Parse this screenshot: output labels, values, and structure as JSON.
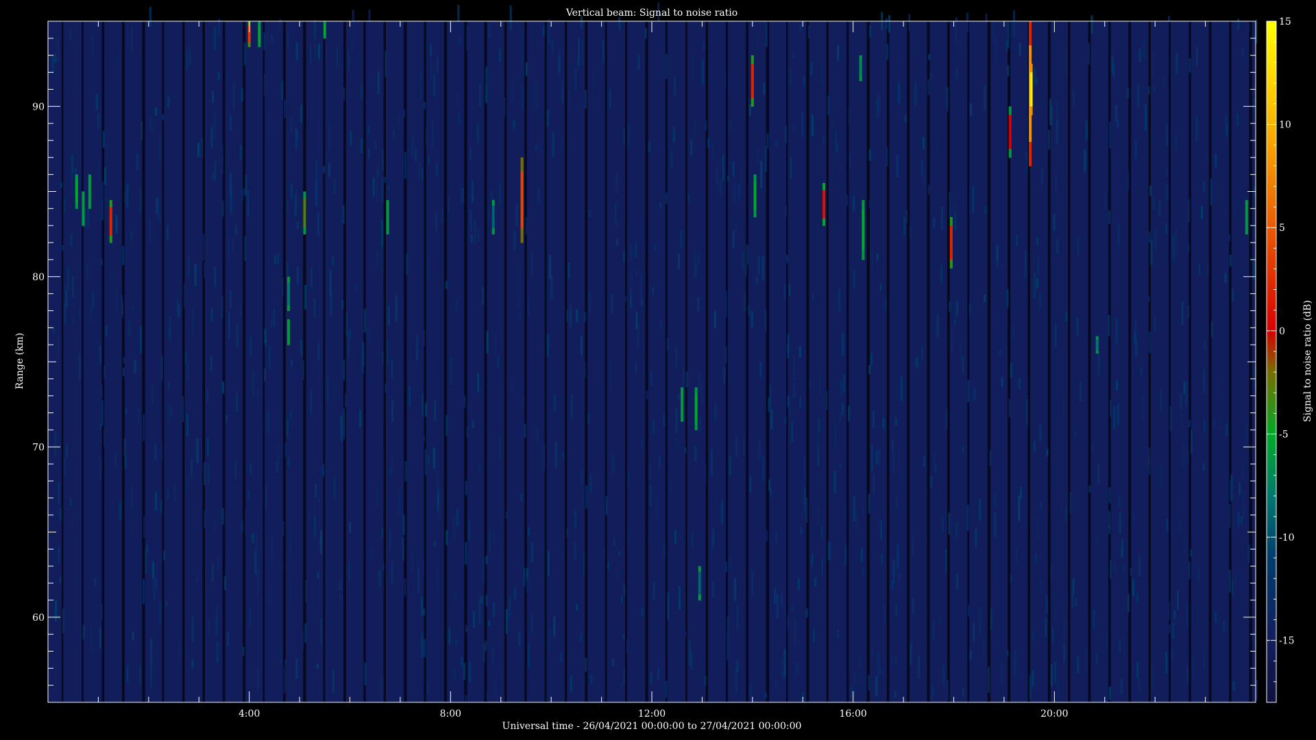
{
  "chart_data": {
    "type": "heatmap",
    "title": "Vertical beam: Signal to noise ratio",
    "xlabel": "Universal time - 26/04/2021 00:00:00 to 27/04/2021 00:00:00",
    "ylabel": "Range (km)",
    "colorbar_label": "Signal to noise ratio (dB)",
    "xlim": [
      0,
      24
    ],
    "ylim": [
      55,
      95
    ],
    "clim": [
      -18,
      15
    ],
    "x_ticks": [
      {
        "value": 4,
        "label": "4:00"
      },
      {
        "value": 8,
        "label": "8:00"
      },
      {
        "value": 12,
        "label": "12:00"
      },
      {
        "value": 16,
        "label": "16:00"
      },
      {
        "value": 20,
        "label": "20:00"
      }
    ],
    "y_ticks": [
      {
        "value": 60,
        "label": "60"
      },
      {
        "value": 70,
        "label": "70"
      },
      {
        "value": 80,
        "label": "80"
      },
      {
        "value": 90,
        "label": "90"
      }
    ],
    "colorbar_ticks": [
      {
        "value": 15,
        "label": "15"
      },
      {
        "value": 10,
        "label": "10"
      },
      {
        "value": 5,
        "label": "5"
      },
      {
        "value": 0,
        "label": "0"
      },
      {
        "value": -5,
        "label": "-5"
      },
      {
        "value": -10,
        "label": "-10"
      },
      {
        "value": -15,
        "label": "-15"
      }
    ],
    "background_snr_db": -15,
    "grid": false,
    "echoes": [
      {
        "t": 0.57,
        "r0": 84,
        "r1": 86,
        "snr": -5
      },
      {
        "t": 0.7,
        "r0": 83,
        "r1": 85,
        "snr": -6
      },
      {
        "t": 0.83,
        "r0": 84,
        "r1": 86,
        "snr": -6
      },
      {
        "t": 1.25,
        "r0": 82,
        "r1": 84.5,
        "snr": 2
      },
      {
        "t": 4.0,
        "r0": 93.5,
        "r1": 95,
        "snr": 3
      },
      {
        "t": 4.2,
        "r0": 93.5,
        "r1": 95,
        "snr": -5
      },
      {
        "t": 4.78,
        "r0": 78,
        "r1": 80,
        "snr": -8
      },
      {
        "t": 4.78,
        "r0": 76,
        "r1": 77.5,
        "snr": -6
      },
      {
        "t": 5.1,
        "r0": 82.5,
        "r1": 85,
        "snr": -3
      },
      {
        "t": 5.5,
        "r0": 94,
        "r1": 95,
        "snr": -5
      },
      {
        "t": 6.75,
        "r0": 82.5,
        "r1": 84.5,
        "snr": -6
      },
      {
        "t": 8.85,
        "r0": 82.5,
        "r1": 84.5,
        "snr": -9
      },
      {
        "t": 9.42,
        "r0": 82,
        "r1": 87,
        "snr": 4
      },
      {
        "t": 12.6,
        "r0": 71.5,
        "r1": 73.5,
        "snr": -6
      },
      {
        "t": 12.88,
        "r0": 71,
        "r1": 73.5,
        "snr": -5
      },
      {
        "t": 12.95,
        "r0": 61,
        "r1": 63,
        "snr": -9
      },
      {
        "t": 14.0,
        "r0": 90,
        "r1": 93,
        "snr": 2
      },
      {
        "t": 14.05,
        "r0": 83.5,
        "r1": 86,
        "snr": -5
      },
      {
        "t": 15.42,
        "r0": 83,
        "r1": 85.5,
        "snr": 1
      },
      {
        "t": 16.15,
        "r0": 91.5,
        "r1": 93,
        "snr": -7
      },
      {
        "t": 16.2,
        "r0": 81,
        "r1": 84.5,
        "snr": -5
      },
      {
        "t": 17.95,
        "r0": 80.5,
        "r1": 83.5,
        "snr": 2
      },
      {
        "t": 19.12,
        "r0": 87,
        "r1": 90,
        "snr": 0
      },
      {
        "t": 19.52,
        "r0": 86.5,
        "r1": 95,
        "snr": 8
      },
      {
        "t": 19.54,
        "r0": 89.5,
        "r1": 92.5,
        "snr": 14
      },
      {
        "t": 20.85,
        "r0": 75.5,
        "r1": 76.5,
        "snr": -8
      },
      {
        "t": 23.82,
        "r0": 82.5,
        "r1": 84.5,
        "snr": -6
      }
    ]
  }
}
